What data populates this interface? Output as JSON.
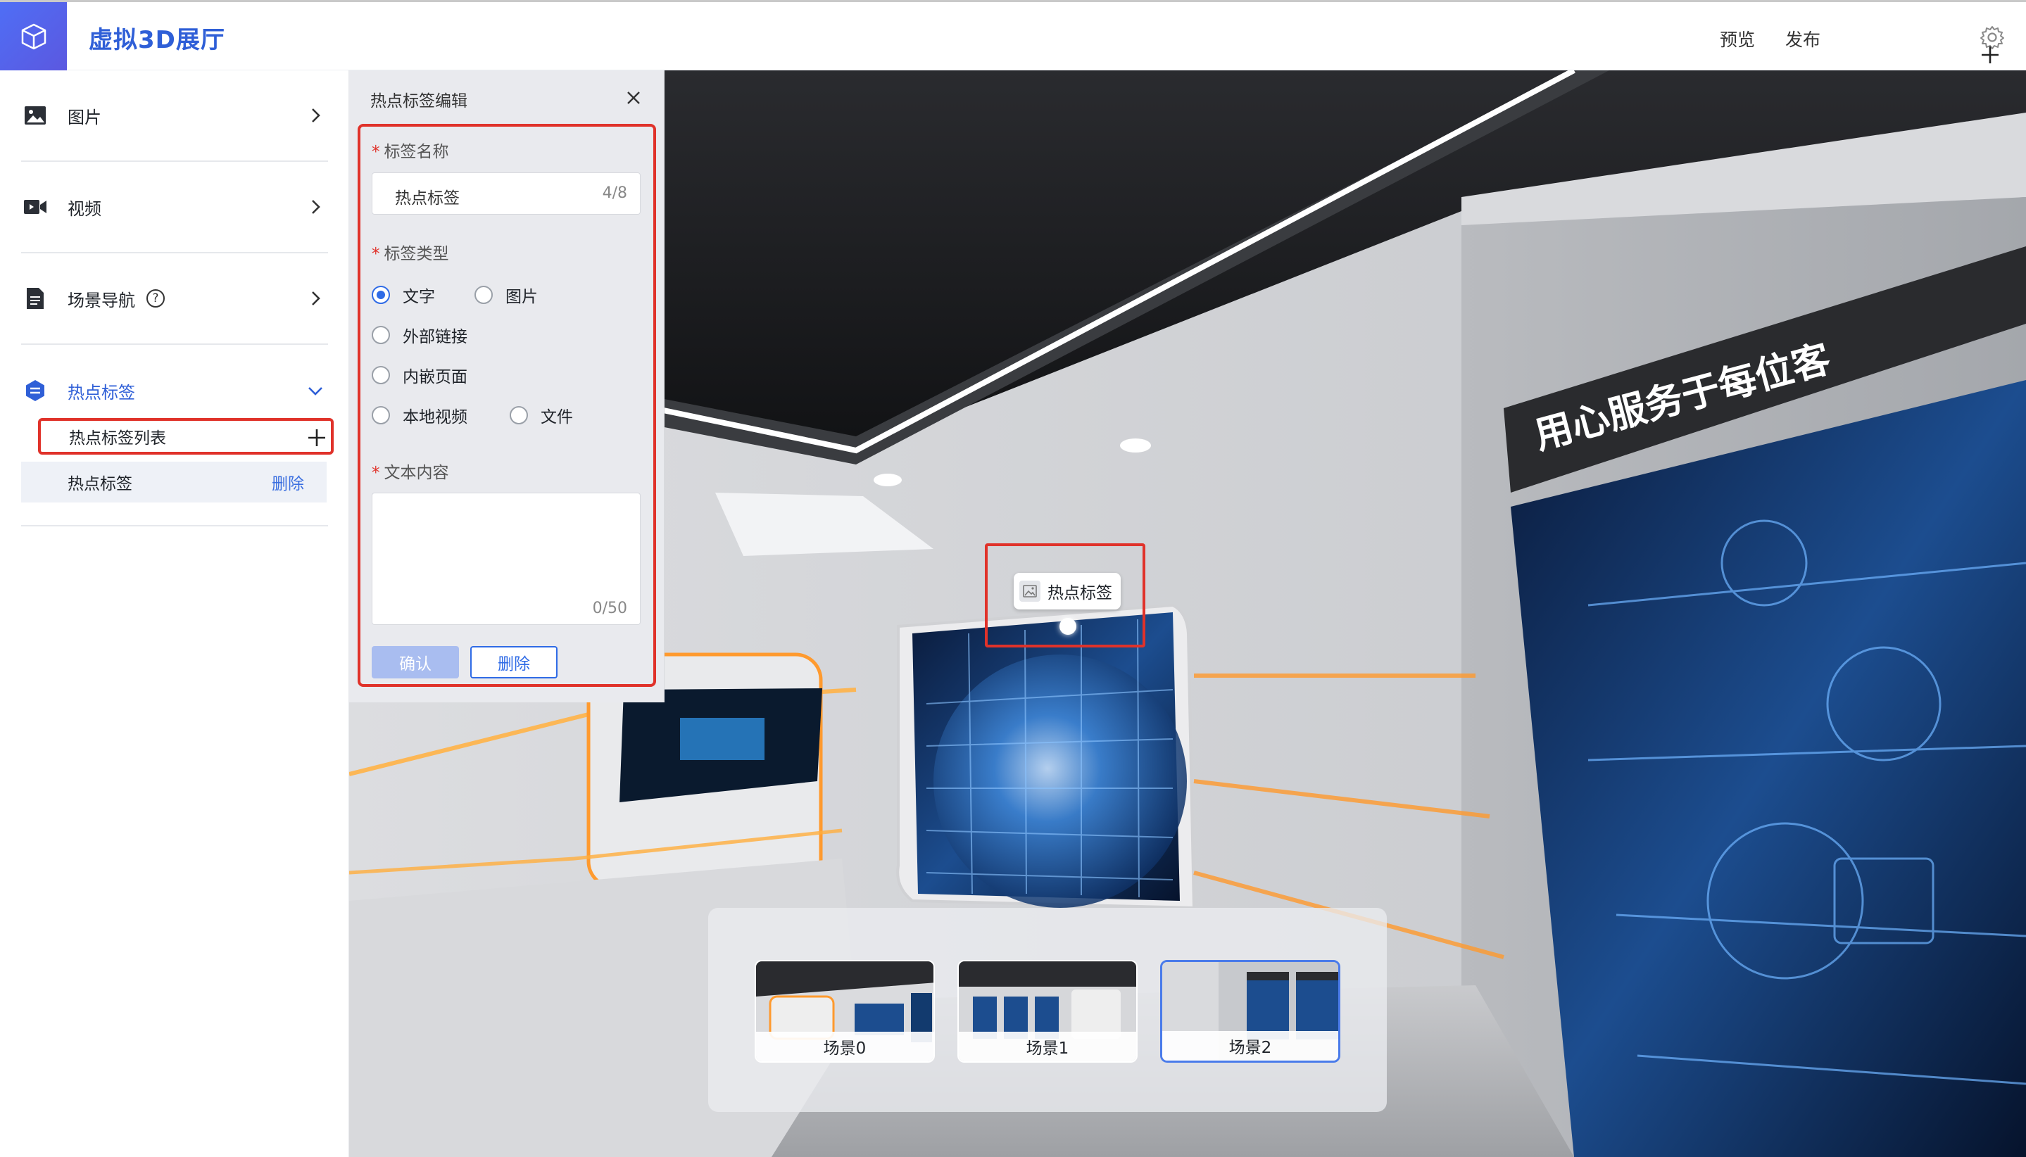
{
  "header": {
    "title": "虚拟3D展厅",
    "preview_label": "预览",
    "publish_label": "发布"
  },
  "sidebar": {
    "items": [
      {
        "label": "图片",
        "icon": "image-icon"
      },
      {
        "label": "视频",
        "icon": "video-icon"
      },
      {
        "label": "场景导航",
        "icon": "document-icon",
        "help": "?"
      },
      {
        "label": "热点标签",
        "icon": "hotspot-icon"
      }
    ],
    "hotspot_list_label": "热点标签列表",
    "hotspot_row": {
      "label": "热点标签",
      "delete_label": "删除"
    }
  },
  "panel": {
    "title": "热点标签编辑",
    "name_label": "标签名称",
    "name_value": "热点标签",
    "name_count": "4/8",
    "type_label": "标签类型",
    "type_options": [
      "文字",
      "图片",
      "外部链接",
      "内嵌页面",
      "本地视频",
      "文件"
    ],
    "type_selected": "文字",
    "content_label": "文本内容",
    "content_count": "0/50",
    "confirm_label": "确认",
    "delete_label": "删除"
  },
  "scene": {
    "banner_text": "用心服务于每位客",
    "hotspot_label": "热点标签",
    "scenes": [
      {
        "label": "场景0",
        "selected": false
      },
      {
        "label": "场景1",
        "selected": false
      },
      {
        "label": "场景2",
        "selected": true
      }
    ]
  },
  "colors": {
    "accent": "#2f5fd7",
    "highlight_frame": "#e0322a",
    "selection": "#4a7bea"
  }
}
